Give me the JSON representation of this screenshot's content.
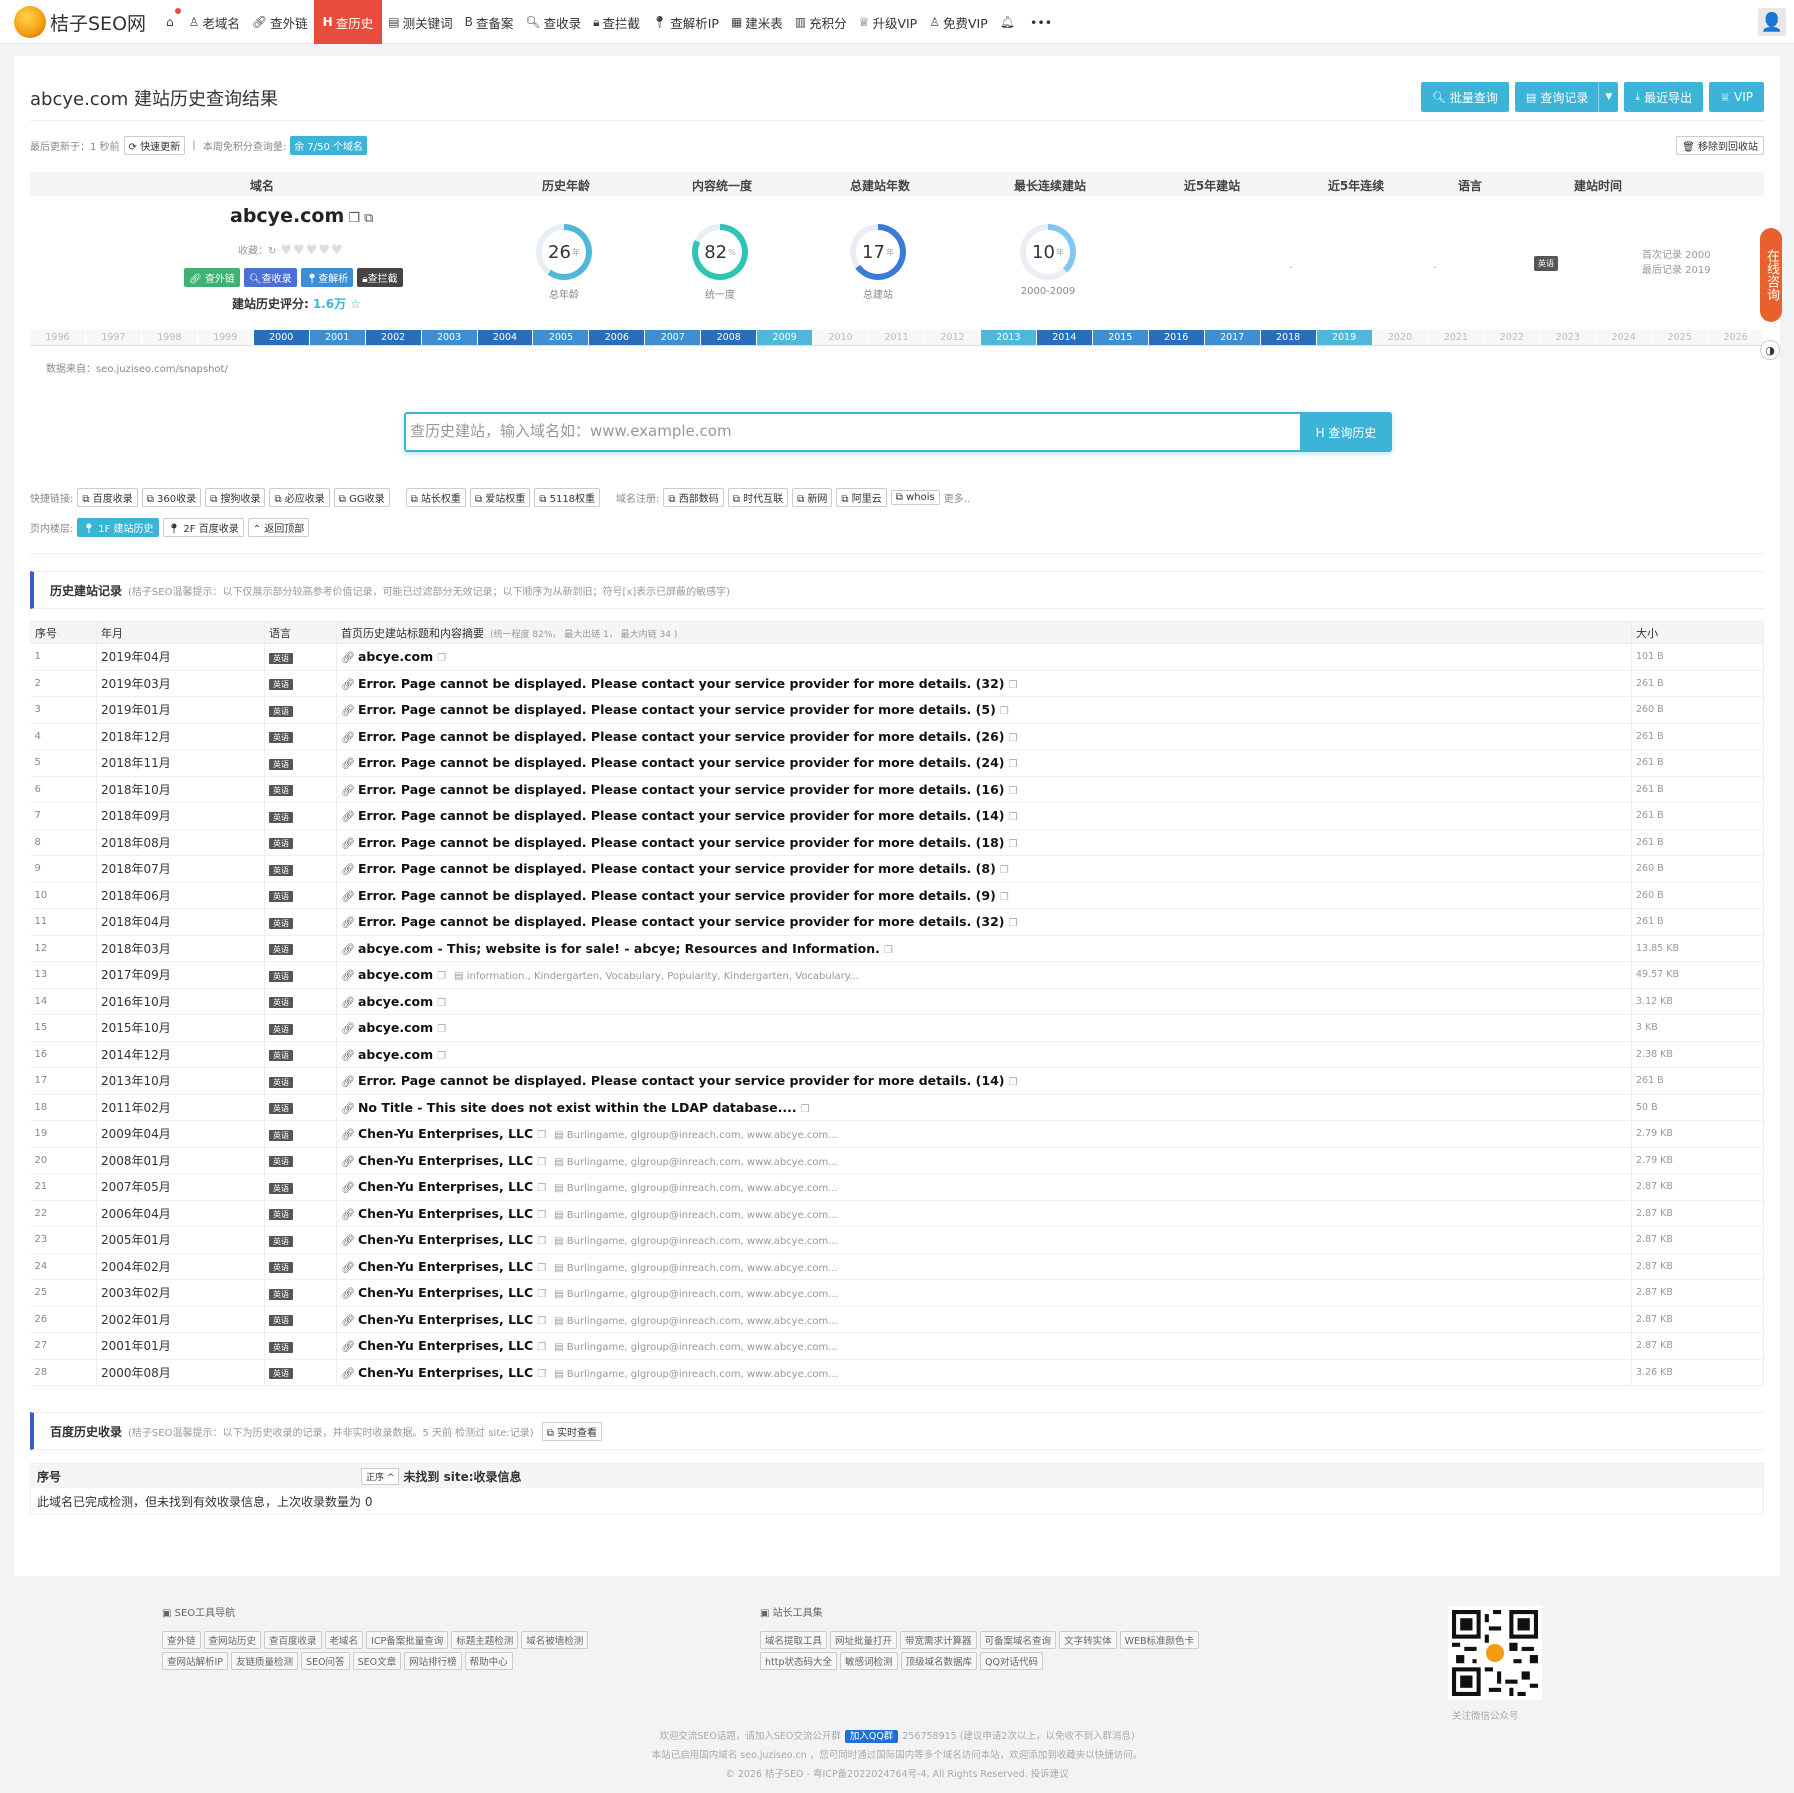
{
  "brand": {
    "name": "桔子SEO网"
  },
  "nav": [
    {
      "icon": "home",
      "label": ""
    },
    {
      "icon": "old-domain",
      "label": "老域名"
    },
    {
      "icon": "link",
      "label": "查外链"
    },
    {
      "icon": "H",
      "label": "查历史",
      "active": true
    },
    {
      "icon": "doc",
      "label": "测关键词"
    },
    {
      "icon": "B",
      "label": "查备案"
    },
    {
      "icon": "search",
      "label": "查收录"
    },
    {
      "icon": "lock",
      "label": "查拦截"
    },
    {
      "icon": "pin",
      "label": "查解析IP"
    },
    {
      "icon": "table",
      "label": "建米表"
    },
    {
      "icon": "chart",
      "label": "充积分"
    },
    {
      "icon": "crown",
      "label": "升级VIP"
    },
    {
      "icon": "user",
      "label": "免费VIP"
    },
    {
      "icon": "bell",
      "label": ""
    },
    {
      "icon": "more",
      "label": "•••"
    }
  ],
  "page": {
    "title": "abcye.com 建站历史查询结果",
    "buttons": {
      "batch": "批量查询",
      "records": "查询记录",
      "export": "最近导出",
      "vip": "VIP"
    },
    "update_prefix": "最后更新于：1 秒前",
    "quick_update": "快速更新",
    "weekly_label": "本周免积分查询量:",
    "weekly_badge": "余 7/50 个域名",
    "recycle": "移除到回收站"
  },
  "summary": {
    "headers": [
      "域名",
      "历史年龄",
      "内容统一度",
      "总建站年数",
      "最长连续建站",
      "近5年建站",
      "近5年连续",
      "语言",
      "建站时间"
    ],
    "domain": "abcye.com",
    "fav_label": "收藏：",
    "tags": [
      "查外链",
      "查收录",
      "查解析",
      "查拦截"
    ],
    "score_label": "建站历史评分:",
    "score_value": "1.6万 ☆",
    "rings": [
      {
        "value": "26",
        "unit": "年",
        "label": "总年龄",
        "pct": 0.6,
        "color": "#4fb8d8"
      },
      {
        "value": "82",
        "unit": "%",
        "label": "统一度",
        "pct": 0.82,
        "color": "#2ec4b6"
      },
      {
        "value": "17",
        "unit": "年",
        "label": "总建站",
        "pct": 0.65,
        "color": "#3a7bd5"
      },
      {
        "value": "10",
        "unit": "年",
        "label": "2000-2009",
        "pct": 0.38,
        "color": "#7ec8f2"
      }
    ],
    "recent5_build": "-",
    "recent5_cont": "-",
    "lang": "英语",
    "first_record": "首次记录 2000",
    "last_record": "最后记录 2019"
  },
  "years": [
    {
      "y": "1996",
      "on": false
    },
    {
      "y": "1997",
      "on": false
    },
    {
      "y": "1998",
      "on": false
    },
    {
      "y": "1999",
      "on": false
    },
    {
      "y": "2000",
      "on": true,
      "c": "#2a6ebb"
    },
    {
      "y": "2001",
      "on": true,
      "c": "#3f8ed0"
    },
    {
      "y": "2002",
      "on": true,
      "c": "#2a6ebb"
    },
    {
      "y": "2003",
      "on": true,
      "c": "#3f8ed0"
    },
    {
      "y": "2004",
      "on": true,
      "c": "#2a6ebb"
    },
    {
      "y": "2005",
      "on": true,
      "c": "#3f8ed0"
    },
    {
      "y": "2006",
      "on": true,
      "c": "#2a6ebb"
    },
    {
      "y": "2007",
      "on": true,
      "c": "#3f8ed0"
    },
    {
      "y": "2008",
      "on": true,
      "c": "#2a6ebb"
    },
    {
      "y": "2009",
      "on": true,
      "c": "#4fb8d8"
    },
    {
      "y": "2010",
      "on": false
    },
    {
      "y": "2011",
      "on": false
    },
    {
      "y": "2012",
      "on": false
    },
    {
      "y": "2013",
      "on": true,
      "c": "#4fb8d8"
    },
    {
      "y": "2014",
      "on": true,
      "c": "#2a6ebb"
    },
    {
      "y": "2015",
      "on": true,
      "c": "#3f8ed0"
    },
    {
      "y": "2016",
      "on": true,
      "c": "#2a6ebb"
    },
    {
      "y": "2017",
      "on": true,
      "c": "#3f8ed0"
    },
    {
      "y": "2018",
      "on": true,
      "c": "#2a6ebb"
    },
    {
      "y": "2019",
      "on": true,
      "c": "#4fb8d8"
    },
    {
      "y": "2020",
      "on": false
    },
    {
      "y": "2021",
      "on": false
    },
    {
      "y": "2022",
      "on": false
    },
    {
      "y": "2023",
      "on": false
    },
    {
      "y": "2024",
      "on": false
    },
    {
      "y": "2025",
      "on": false
    },
    {
      "y": "2026",
      "on": false
    }
  ],
  "data_source": "数据来自：seo.juziseo.com/snapshot/",
  "search": {
    "placeholder": "查历史建站，输入域名如：www.example.com",
    "button": "H 查询历史"
  },
  "quicklinks": {
    "label": "快捷链接:",
    "group1": [
      "百度收录",
      "360收录",
      "搜狗收录",
      "必应收录",
      "GG收录"
    ],
    "group2": [
      "站长权重",
      "爱站权重",
      "5118权重"
    ],
    "reg_label": "域名注册:",
    "group3": [
      "西部数码",
      "时代互联",
      "新网",
      "阿里云",
      "whois"
    ],
    "more": "更多..",
    "floor_label": "页内楼层:",
    "floors": [
      "1F 建站历史",
      "2F 百度收录",
      "返回顶部"
    ]
  },
  "history": {
    "title": "历史建站记录",
    "hint": "(桔子SEO温馨提示：以下仅展示部分较高参考价值记录，可能已过滤部分无效记录；以下顺序为从新到旧；符号[x]表示已屏蔽的敏感字)",
    "columns": {
      "no": "序号",
      "ym": "年月",
      "lang": "语言",
      "title": "首页历史建站标题和内容摘要",
      "title_sub": "(统一程度 82%， 最大出链 1， 最大内链 34 )",
      "size": "大小"
    },
    "rows": [
      {
        "no": "1",
        "ym": "2019年04月",
        "lang": "英语",
        "title": "abcye.com",
        "snip": "",
        "size": "101 B"
      },
      {
        "no": "2",
        "ym": "2019年03月",
        "lang": "英语",
        "title": "Error. Page cannot be displayed. Please contact your service provider for more details. (32)",
        "snip": "",
        "size": "261 B"
      },
      {
        "no": "3",
        "ym": "2019年01月",
        "lang": "英语",
        "title": "Error. Page cannot be displayed. Please contact your service provider for more details. (5)",
        "snip": "",
        "size": "260 B"
      },
      {
        "no": "4",
        "ym": "2018年12月",
        "lang": "英语",
        "title": "Error. Page cannot be displayed. Please contact your service provider for more details. (26)",
        "snip": "",
        "size": "261 B"
      },
      {
        "no": "5",
        "ym": "2018年11月",
        "lang": "英语",
        "title": "Error. Page cannot be displayed. Please contact your service provider for more details. (24)",
        "snip": "",
        "size": "261 B"
      },
      {
        "no": "6",
        "ym": "2018年10月",
        "lang": "英语",
        "title": "Error. Page cannot be displayed. Please contact your service provider for more details. (16)",
        "snip": "",
        "size": "261 B"
      },
      {
        "no": "7",
        "ym": "2018年09月",
        "lang": "英语",
        "title": "Error. Page cannot be displayed. Please contact your service provider for more details. (14)",
        "snip": "",
        "size": "261 B"
      },
      {
        "no": "8",
        "ym": "2018年08月",
        "lang": "英语",
        "title": "Error. Page cannot be displayed. Please contact your service provider for more details. (18)",
        "snip": "",
        "size": "261 B"
      },
      {
        "no": "9",
        "ym": "2018年07月",
        "lang": "英语",
        "title": "Error. Page cannot be displayed. Please contact your service provider for more details. (8)",
        "snip": "",
        "size": "260 B"
      },
      {
        "no": "10",
        "ym": "2018年06月",
        "lang": "英语",
        "title": "Error. Page cannot be displayed. Please contact your service provider for more details. (9)",
        "snip": "",
        "size": "260 B"
      },
      {
        "no": "11",
        "ym": "2018年04月",
        "lang": "英语",
        "title": "Error. Page cannot be displayed. Please contact your service provider for more details. (32)",
        "snip": "",
        "size": "261 B"
      },
      {
        "no": "12",
        "ym": "2018年03月",
        "lang": "英语",
        "title": "abcye.com - This; website is for sale! - abcye; Resources and Information.",
        "snip": "",
        "size": "13.85 KB"
      },
      {
        "no": "13",
        "ym": "2017年09月",
        "lang": "英语",
        "title": "abcye.com",
        "snip": "information., Kindergarten, Vocabulary, Popularity, Kindergarten, Vocabulary...",
        "size": "49.57 KB"
      },
      {
        "no": "14",
        "ym": "2016年10月",
        "lang": "英语",
        "title": "abcye.com",
        "snip": "",
        "size": "3.12 KB"
      },
      {
        "no": "15",
        "ym": "2015年10月",
        "lang": "英语",
        "title": "abcye.com",
        "snip": "",
        "size": "3 KB"
      },
      {
        "no": "16",
        "ym": "2014年12月",
        "lang": "英语",
        "title": "abcye.com",
        "snip": "",
        "size": "2.38 KB"
      },
      {
        "no": "17",
        "ym": "2013年10月",
        "lang": "英语",
        "title": "Error. Page cannot be displayed. Please contact your service provider for more details. (14)",
        "snip": "",
        "size": "261 B"
      },
      {
        "no": "18",
        "ym": "2011年02月",
        "lang": "英语",
        "title": "No Title - This site does not exist within the LDAP database....",
        "snip": "",
        "size": "50 B"
      },
      {
        "no": "19",
        "ym": "2009年04月",
        "lang": "英语",
        "title": "Chen-Yu Enterprises, LLC",
        "snip": "Burlingame, glgroup@inreach.com, www.abcye.com...",
        "size": "2.79 KB"
      },
      {
        "no": "20",
        "ym": "2008年01月",
        "lang": "英语",
        "title": "Chen-Yu Enterprises, LLC",
        "snip": "Burlingame, glgroup@inreach.com, www.abcye.com...",
        "size": "2.79 KB"
      },
      {
        "no": "21",
        "ym": "2007年05月",
        "lang": "英语",
        "title": "Chen-Yu Enterprises, LLC",
        "snip": "Burlingame, glgroup@inreach.com, www.abcye.com...",
        "size": "2.87 KB"
      },
      {
        "no": "22",
        "ym": "2006年04月",
        "lang": "英语",
        "title": "Chen-Yu Enterprises, LLC",
        "snip": "Burlingame, glgroup@inreach.com, www.abcye.com...",
        "size": "2.87 KB"
      },
      {
        "no": "23",
        "ym": "2005年01月",
        "lang": "英语",
        "title": "Chen-Yu Enterprises, LLC",
        "snip": "Burlingame, glgroup@inreach.com, www.abcye.com...",
        "size": "2.87 KB"
      },
      {
        "no": "24",
        "ym": "2004年02月",
        "lang": "英语",
        "title": "Chen-Yu Enterprises, LLC",
        "snip": "Burlingame, glgroup@inreach.com, www.abcye.com...",
        "size": "2.87 KB"
      },
      {
        "no": "25",
        "ym": "2003年02月",
        "lang": "英语",
        "title": "Chen-Yu Enterprises, LLC",
        "snip": "Burlingame, glgroup@inreach.com, www.abcye.com...",
        "size": "2.87 KB"
      },
      {
        "no": "26",
        "ym": "2002年01月",
        "lang": "英语",
        "title": "Chen-Yu Enterprises, LLC",
        "snip": "Burlingame, glgroup@inreach.com, www.abcye.com...",
        "size": "2.87 KB"
      },
      {
        "no": "27",
        "ym": "2001年01月",
        "lang": "英语",
        "title": "Chen-Yu Enterprises, LLC",
        "snip": "Burlingame, glgroup@inreach.com, www.abcye.com...",
        "size": "2.87 KB"
      },
      {
        "no": "28",
        "ym": "2000年08月",
        "lang": "英语",
        "title": "Chen-Yu Enterprises, LLC",
        "snip": "Burlingame, glgroup@inreach.com, www.abcye.com...",
        "size": "3.26 KB"
      }
    ]
  },
  "baidu": {
    "title": "百度历史收录",
    "hint": "(桔子SEO温馨提示：以下为历史收录的记录，并非实时收录数据。5 天前 检测过 site:记录)",
    "realtime": "实时查看",
    "col_no": "序号",
    "sort": "正序 ^",
    "col_info": "未找到 site:收录信息",
    "body": "此域名已完成检测，但未找到有效收录信息，上次收录数量为 0"
  },
  "side": {
    "consult": "在线咨询"
  },
  "footer": {
    "seo_nav_title": "SEO工具导航",
    "seo_nav_row1": [
      "查外链",
      "查网站历史",
      "查百度收录",
      "老域名",
      "ICP备案批量查询",
      "标题主题检测",
      "域名被墙检测"
    ],
    "seo_nav_row2": [
      "查网站解析IP",
      "友链质量检测",
      "SEO问答",
      "SEO文章",
      "网站排行榜",
      "帮助中心"
    ],
    "tools_title": "站长工具集",
    "tools_row1": [
      "域名提取工具",
      "网址批量打开",
      "带宽需求计算器",
      "可备案域名查询",
      "文字转实体",
      "WEB标准颜色卡"
    ],
    "tools_row2": [
      "http状态码大全",
      "敏感词检测",
      "顶级域名数据库",
      "QQ对话代码"
    ],
    "qr_label": "关注微信公众号",
    "line1_a": "欢迎交流SEO话题，请加入SEO交流公开群",
    "line1_badge": "加入QQ群",
    "line1_b": "256758915 (建议申请2次以上，以免收不到入群消息)",
    "line2": "本站已启用国内域名 seo.juziseo.cn ，您可同时通过国际国内等多个域名访问本站，欢迎添加到收藏夹以快捷访问。",
    "line3": "© 2026 桔子SEO  -  粤ICP备2022024764号-4, All Rights Reserved. 投诉建议"
  }
}
